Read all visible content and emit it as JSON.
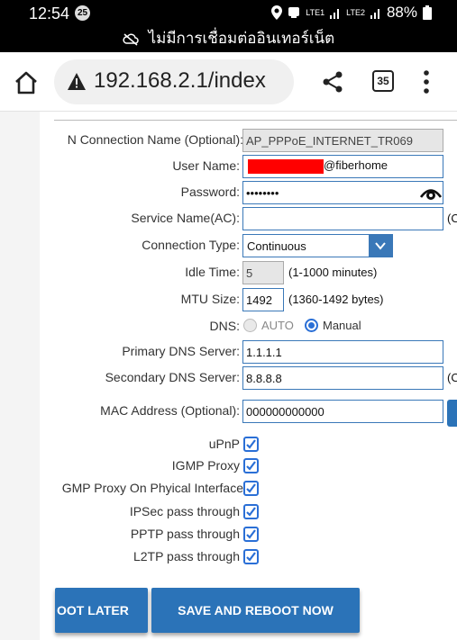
{
  "status_bar": {
    "time": "12:54",
    "notification_count": "25",
    "network_1": "LTE1",
    "network_2": "LTE2",
    "battery": "88%"
  },
  "offline_message": "ไม่มีการเชื่อมต่ออินเทอร์เน็ต",
  "browser": {
    "url": "192.168.2.1/index",
    "tab_count": "35"
  },
  "form": {
    "connection_name": {
      "label": "N Connection Name (Optional):",
      "value": "AP_PPPoE_INTERNET_TR069"
    },
    "user_name": {
      "label": "User Name:",
      "value_suffix": "@fiberhome"
    },
    "password": {
      "label": "Password:",
      "value": "••••••••"
    },
    "service_name": {
      "label": "Service Name(AC):",
      "value": "",
      "clipped_hint": "(O"
    },
    "connection_type": {
      "label": "Connection Type:",
      "selected": "Continuous"
    },
    "idle_time": {
      "label": "Idle Time:",
      "value": "5",
      "hint": "(1-1000 minutes)"
    },
    "mtu_size": {
      "label": "MTU Size:",
      "value": "1492",
      "hint": "(1360-1492 bytes)"
    },
    "dns": {
      "label": "DNS:",
      "option_auto": "AUTO",
      "option_manual": "Manual",
      "selected": "Manual"
    },
    "primary_dns": {
      "label": "Primary DNS Server:",
      "value": "1.1.1.1"
    },
    "secondary_dns": {
      "label": "Secondary DNS Server:",
      "value": "8.8.8.8",
      "clipped_hint": "(O"
    },
    "mac_address": {
      "label": "MAC Address (Optional):",
      "value": "000000000000"
    },
    "upnp": {
      "label": "uPnP",
      "checked": true
    },
    "igmp_proxy": {
      "label": "IGMP Proxy",
      "checked": true
    },
    "igmp_phy": {
      "label": "GMP Proxy On Phyical Interface",
      "checked": true
    },
    "ipsec": {
      "label": "IPSec pass through",
      "checked": true
    },
    "pptp": {
      "label": "PPTP pass through",
      "checked": true
    },
    "l2tp": {
      "label": "L2TP pass through",
      "checked": true
    }
  },
  "buttons": {
    "reboot_later": "OOT LATER",
    "save_reboot_now": "SAVE AND REBOOT NOW"
  },
  "colors": {
    "accent": "#2b73b8",
    "radio_selected": "#2a6fd6",
    "redaction": "#ff0000"
  }
}
